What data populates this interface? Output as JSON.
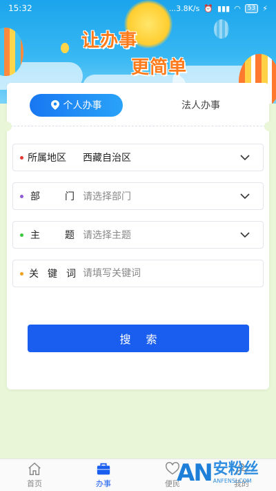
{
  "status_bar": {
    "time": "15:32",
    "net_speed": "...3.8K/s",
    "battery": "53"
  },
  "banner": {
    "slogan_line1": "让办事",
    "slogan_line2": "更简单"
  },
  "tabs": [
    {
      "label": "个人办事",
      "active": true
    },
    {
      "label": "法人办事",
      "active": false
    }
  ],
  "form": {
    "region": {
      "label": "所属地区",
      "value": "西藏自治区",
      "dot_color": "#e53935"
    },
    "department": {
      "label": "部门",
      "placeholder": "请选择部门",
      "dot_color": "#8e5ad6"
    },
    "topic": {
      "label": "主题",
      "placeholder": "请选择主题",
      "dot_color": "#3cc93c"
    },
    "keyword": {
      "label": "关键词",
      "placeholder": "请填写关键词",
      "dot_color": "#f0a020"
    }
  },
  "search_button": "搜索",
  "bottom_nav": [
    {
      "label": "首页",
      "icon": "home-icon",
      "active": false
    },
    {
      "label": "办事",
      "icon": "briefcase-icon",
      "active": true
    },
    {
      "label": "便民",
      "icon": "heart-icon",
      "active": false
    },
    {
      "label": "我的",
      "icon": "user-icon",
      "active": false
    }
  ],
  "watermark": {
    "logo": "AN",
    "name": "安粉丝",
    "url": "ANFENSI.COM"
  },
  "colors": {
    "primary": "#1a5ef0",
    "page_bg": "#e9f6d8",
    "banner": "#1ba4ec"
  }
}
